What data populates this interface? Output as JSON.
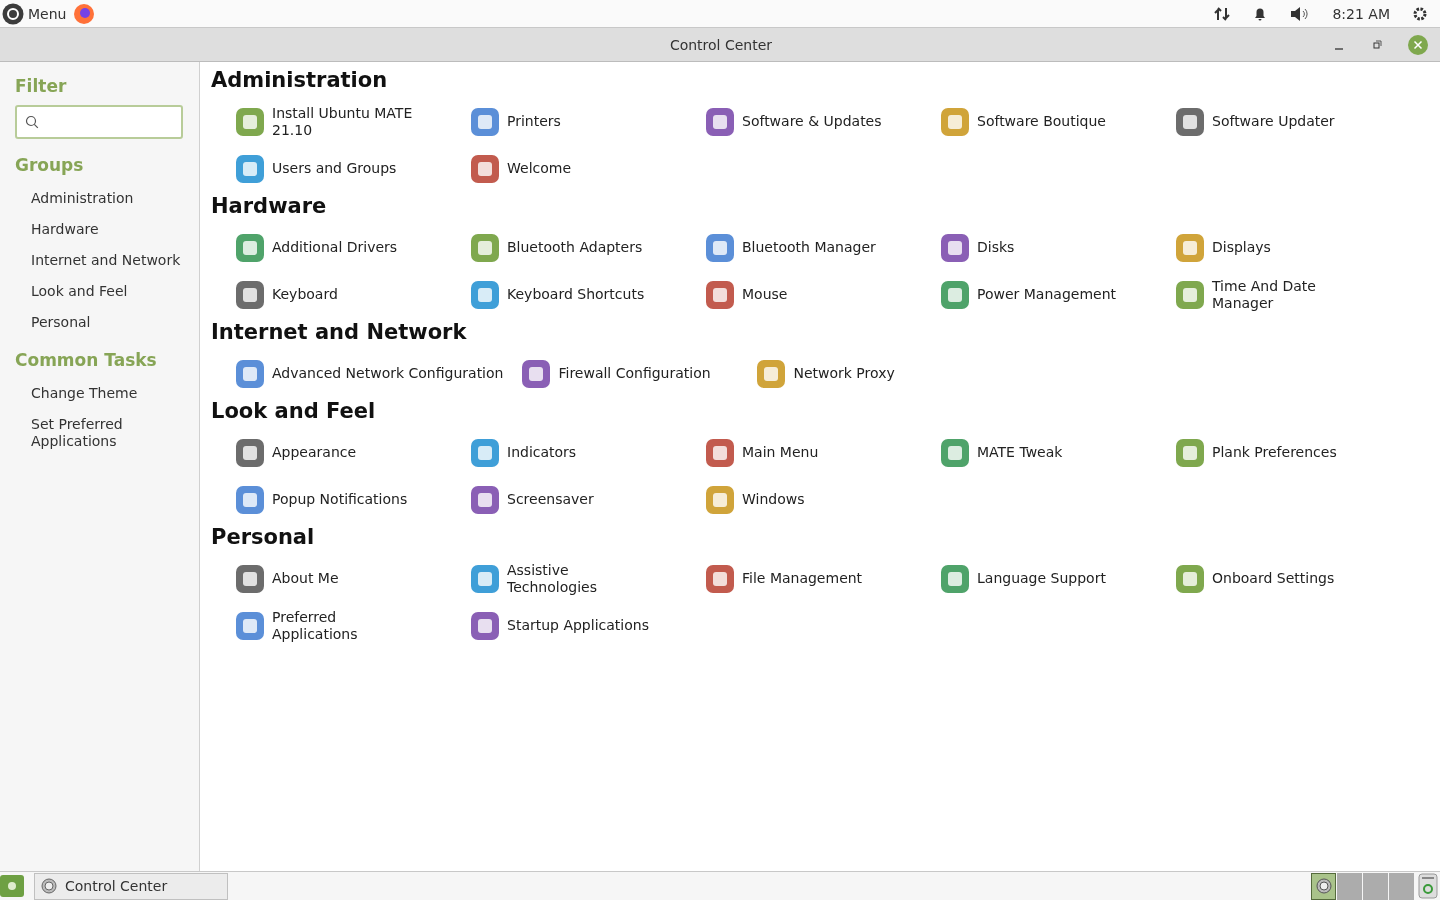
{
  "top_panel": {
    "menu_label": "Menu",
    "clock": "8:21 AM"
  },
  "window": {
    "title": "Control Center"
  },
  "sidebar": {
    "filter_heading": "Filter",
    "groups_heading": "Groups",
    "groups": [
      "Administration",
      "Hardware",
      "Internet and Network",
      "Look and Feel",
      "Personal"
    ],
    "tasks_heading": "Common Tasks",
    "tasks": [
      "Change Theme",
      "Set Preferred Applications"
    ]
  },
  "sections": [
    {
      "title": "Administration",
      "items": [
        "Install Ubuntu MATE 21.10",
        "Printers",
        "Software & Updates",
        "Software Boutique",
        "Software Updater",
        "Users and Groups",
        "Welcome"
      ]
    },
    {
      "title": "Hardware",
      "items": [
        "Additional Drivers",
        "Bluetooth Adapters",
        "Bluetooth Manager",
        "Disks",
        "Displays",
        "Keyboard",
        "Keyboard Shortcuts",
        "Mouse",
        "Power Management",
        "Time And Date Manager"
      ]
    },
    {
      "title": "Internet and Network",
      "items": [
        "Advanced Network Configuration",
        "Firewall Configuration",
        "Network Proxy"
      ]
    },
    {
      "title": "Look and Feel",
      "items": [
        "Appearance",
        "Indicators",
        "Main Menu",
        "MATE Tweak",
        "Plank Preferences",
        "Popup Notifications",
        "Screensaver",
        "Windows"
      ]
    },
    {
      "title": "Personal",
      "items": [
        "About Me",
        "Assistive Technologies",
        "File Management",
        "Language Support",
        "Onboard Settings",
        "Preferred Applications",
        "Startup Applications"
      ]
    }
  ],
  "bottom_panel": {
    "task": "Control Center",
    "workspaces": [
      {
        "selected": true
      },
      {
        "selected": false
      },
      {
        "selected": false
      },
      {
        "selected": false
      }
    ]
  }
}
